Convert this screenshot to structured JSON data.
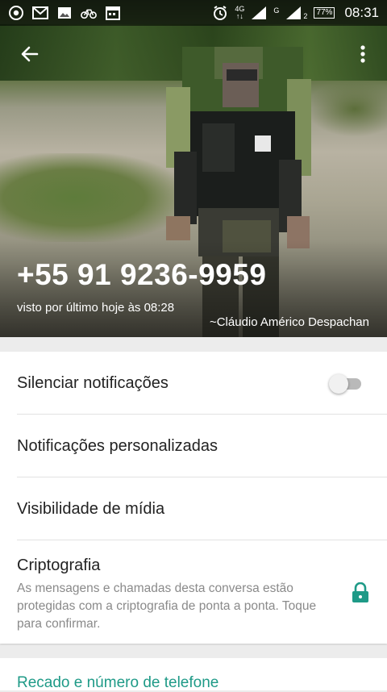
{
  "status_bar": {
    "icons": [
      "chrome-icon",
      "gmail-icon",
      "gallery-icon",
      "cycle-icon",
      "calendar-icon"
    ],
    "network_label": "4G",
    "network_sub": "↑↓",
    "signal2_label": "G",
    "sim_number": "2",
    "battery": "77%",
    "time": "08:31"
  },
  "header": {
    "back_icon": "arrow-left-icon",
    "menu_icon": "more-vert-icon",
    "phone_number": "+55 91 9236-9959",
    "last_seen": "visto por último hoje às 08:28",
    "push_name": "~Cláudio Américo Despachan"
  },
  "settings": {
    "mute_label": "Silenciar notificações",
    "mute_on": false,
    "custom_notifications_label": "Notificações personalizadas",
    "media_visibility_label": "Visibilidade de mídia",
    "encryption_label": "Criptografia",
    "encryption_desc": "As mensagens e chamadas desta conversa estão protegidas com a criptografia de ponta a ponta. Toque para confirmar.",
    "lock_icon": "lock-icon"
  },
  "about_section": {
    "label": "Recado e número de telefone"
  },
  "colors": {
    "accent": "#1e9a87",
    "toggle_track": "#b9b9b9"
  }
}
